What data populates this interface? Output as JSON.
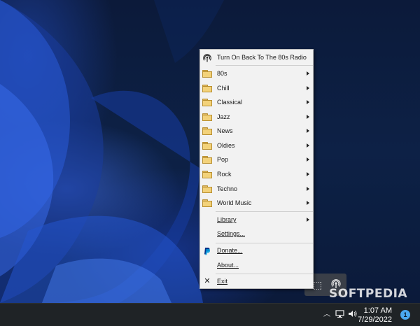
{
  "menu": {
    "turn_on": "Turn On Back To The 80s Radio",
    "genres": [
      {
        "label": "80s"
      },
      {
        "label": "Chill"
      },
      {
        "label": "Classical"
      },
      {
        "label": "Jazz"
      },
      {
        "label": "News"
      },
      {
        "label": "Oldies"
      },
      {
        "label": "Pop"
      },
      {
        "label": "Rock"
      },
      {
        "label": "Techno"
      },
      {
        "label": "World Music"
      }
    ],
    "library": "Library",
    "settings": "Settings...",
    "donate": "Donate...",
    "about": "About...",
    "exit": "Exit"
  },
  "taskbar": {
    "time": "1:07 AM",
    "date": "7/29/2022",
    "notification_count": "1"
  },
  "watermark": "SOFTPEDIA",
  "icons": {
    "radio": "radio-broadcast-icon",
    "folder": "folder-icon",
    "paypal": "paypal-icon",
    "exit": "close-icon"
  },
  "colors": {
    "menu_bg": "#f2f2f2",
    "taskbar_bg": "#1f2326",
    "paypal_blue": "#003087",
    "paypal_light": "#009cde",
    "badge": "#4aa8f0"
  }
}
